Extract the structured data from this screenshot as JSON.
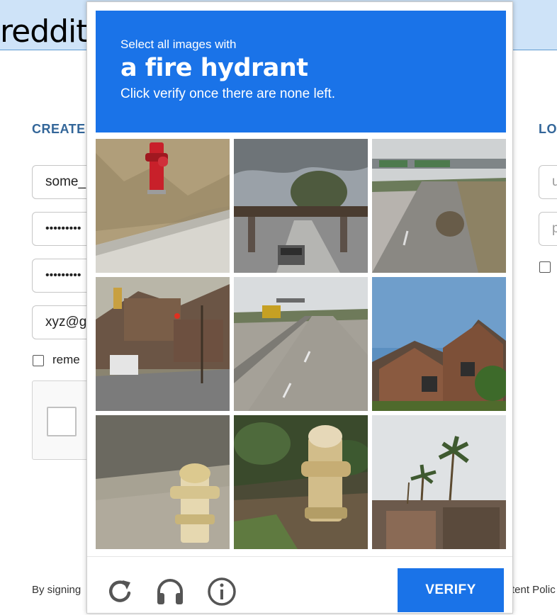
{
  "page": {
    "logo_text": "reddit",
    "create_title": "CREATE",
    "login_title": "LO",
    "username_value": "some_",
    "password_mask": "•••••••••",
    "password_confirm_mask": "•••••••••",
    "email_value": "xyz@g",
    "remember_label": "reme",
    "login_username_placeholder": "u",
    "login_password_placeholder": "p",
    "footer_left": "By signing",
    "footer_right": "tent Polic"
  },
  "captcha": {
    "instruction_line1": "Select all images with",
    "target_object": "a fire hydrant",
    "instruction_line3": "Click verify once there are none left.",
    "verify_label": "VERIFY",
    "icons": [
      "reload-icon",
      "audio-headphones-icon",
      "info-icon"
    ],
    "colors": {
      "accent": "#1a73e8",
      "border": "#cccccc"
    },
    "tiles": [
      {
        "id": 1,
        "scene": "fire hydrant on dry grass"
      },
      {
        "id": 2,
        "scene": "road under railway bridge"
      },
      {
        "id": 3,
        "scene": "highway with overhead sign"
      },
      {
        "id": 4,
        "scene": "intersection with traffic lights"
      },
      {
        "id": 5,
        "scene": "divided highway"
      },
      {
        "id": 6,
        "scene": "brick house"
      },
      {
        "id": 7,
        "scene": "fire hydrant in gravel"
      },
      {
        "id": 8,
        "scene": "fire hydrant near plants"
      },
      {
        "id": 9,
        "scene": "palm trees and building"
      }
    ]
  }
}
